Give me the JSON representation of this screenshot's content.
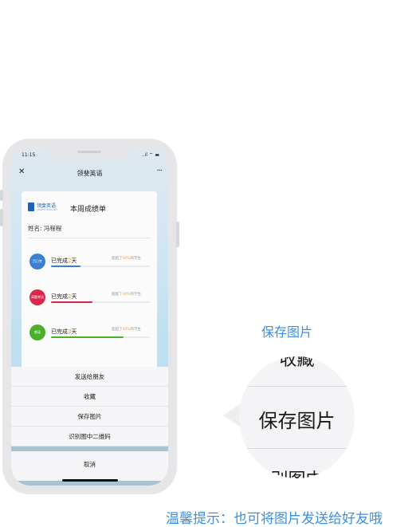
{
  "phone": {
    "status_time": "11:15",
    "status_icons": "..ıl ⌔ ▬",
    "nav_title": "领斐英语",
    "close_icon": "✕",
    "more_icon": "···"
  },
  "card": {
    "logo_text": "领斐英语",
    "logo_sub": "LINGFEI ENGLISH",
    "title": "本周成绩单",
    "student": "姓名: 冯程程",
    "rows": [
      {
        "badge": "百日考",
        "text_prefix": "已完成",
        "days": "2",
        "text_suffix": "天",
        "stat_prefix": "超越了",
        "pct": "50%",
        "stat_suffix": "的学生",
        "color": "#3a7fd0",
        "progress": 0.3
      },
      {
        "badge": "高题考试",
        "text_prefix": "已完成",
        "days": "2",
        "text_suffix": "天",
        "stat_prefix": "超越了",
        "pct": "40%",
        "stat_suffix": "的学生",
        "color": "#d9284e",
        "progress": 0.42
      },
      {
        "badge": "朗读",
        "text_prefix": "已完成",
        "days": "3",
        "text_suffix": "天",
        "stat_prefix": "超越了",
        "pct": "40%",
        "stat_suffix": "的学生",
        "color": "#4caf2a",
        "progress": 0.73
      }
    ]
  },
  "sheet": {
    "items": [
      "发送给朋友",
      "收藏",
      "保存图片",
      "识别图中二维码"
    ],
    "cancel": "取消"
  },
  "magnifier": {
    "callout": "保存图片",
    "top_fragment": "收藏",
    "main_item": "保存图片",
    "bottom_fragment": "识别图中二"
  },
  "tip": "温馨提示：也可将图片发送给好友哦"
}
